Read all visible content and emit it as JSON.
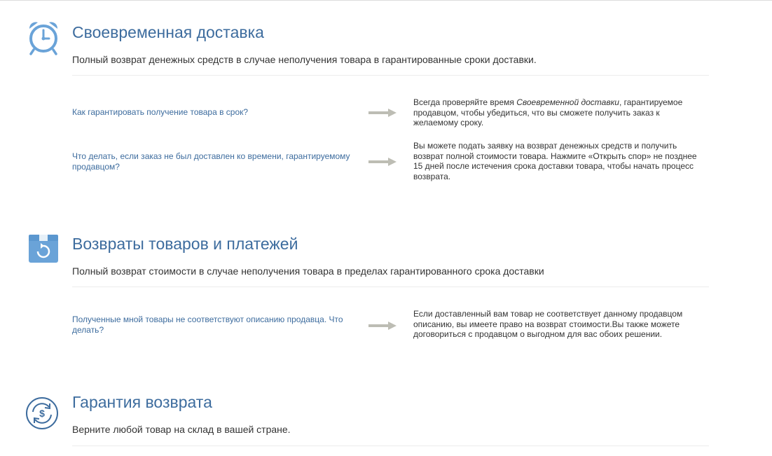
{
  "colors": {
    "accent": "#3d6c9e",
    "icon_blue": "#6aa3d8",
    "arrow_gray": "#bdbdb4",
    "text": "#333333",
    "divider": "#ececec"
  },
  "sections": [
    {
      "icon": "alarm-clock-icon",
      "title": "Своевременная доставка",
      "description": "Полный возврат денежных средств в случае неполучения товара в гарантированные сроки доставки.",
      "faqs": [
        {
          "question": "Как гарантировать получение товара в срок?",
          "answer_pre": "Всегда проверяйте время ",
          "answer_em": "Своевременной доставки",
          "answer_post": ", гарантируемое продавцом, чтобы убедиться, что вы сможете получить заказ к желаемому сроку."
        },
        {
          "question": "Что делать, если заказ не был доставлен ко времени, гарантируемому продавцом?",
          "answer": "Вы можете подать заявку на возврат денежных средств и получить возврат полной стоимости товара. Нажмите «Открыть спор» не позднее 15 дней после истечения срока доставки товара, чтобы начать процесс возврата."
        }
      ]
    },
    {
      "icon": "return-box-icon",
      "title": "Возвраты товаров и платежей",
      "description": "Полный возврат стоимости в случае неполучения товара в пределах гарантированного срока доставки",
      "faqs": [
        {
          "question": "Полученные мной товары не соответствуют описанию продавца. Что делать?",
          "answer": "Если доставленный вам товар не соответствует данному продавцом описанию, вы имеете право на возврат стоимости.Вы также можете договориться с продавцом о выгодном для вас обоих решении."
        }
      ]
    },
    {
      "icon": "money-back-icon",
      "title": "Гарантия возврата",
      "description": "Верните любой товар на склад в вашей стране."
    }
  ]
}
